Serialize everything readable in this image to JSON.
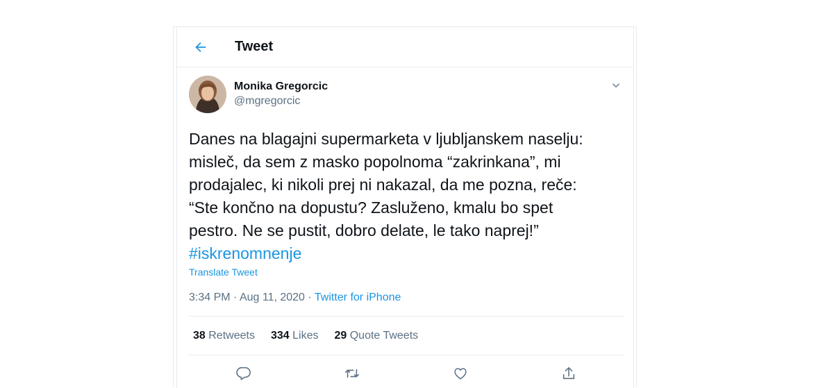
{
  "header": {
    "title": "Tweet"
  },
  "author": {
    "name": "Monika Gregorcic",
    "handle": "@mgregorcic"
  },
  "tweet": {
    "text": "Danes na blagajni supermarketa v ljubljanskem naselju:\nmisleč, da sem z masko popolnoma “zakrinkana”, mi\nprodajalec, ki nikoli prej ni nakazal, da me pozna, reče:\n“Ste končno na dopustu? Zasluženo, kmalu bo spet\npestro. Ne se pustit, dobro delate, le tako naprej!”\n",
    "hashtag": "#iskrenomnenje",
    "translate": "Translate Tweet",
    "time": "3:34 PM",
    "date": "Aug 11, 2020",
    "separator": "·",
    "source": "Twitter for iPhone"
  },
  "stats": {
    "retweets_count": "38",
    "retweets_label": "Retweets",
    "likes_count": "334",
    "likes_label": "Likes",
    "quotes_count": "29",
    "quotes_label": "Quote Tweets"
  },
  "icons": {
    "back": "arrow-left-icon",
    "caret": "chevron-down-icon",
    "reply": "reply-icon",
    "retweet": "retweet-icon",
    "like": "heart-icon",
    "share": "share-icon"
  },
  "colors": {
    "accent": "#1b95e0",
    "text": "#0f1419",
    "secondary": "#5b7083",
    "border": "#e6ecf0"
  }
}
